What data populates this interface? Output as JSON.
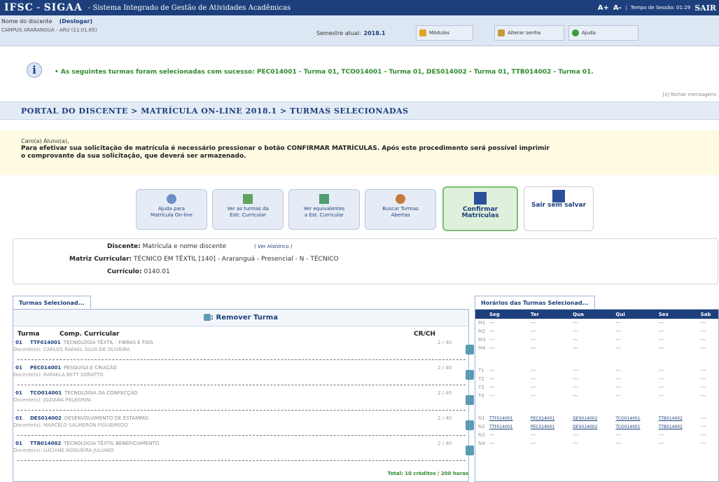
{
  "top": {
    "brand_ifsc": "IFSC",
    "brand_sep": "-",
    "brand_sigaa": "SIGAA",
    "brand_dash": "-",
    "system_name": "Sistema Integrado de Gestão de Atividades Acadêmicas",
    "font_increase": "A+",
    "font_decrease": "A-",
    "session_time": "Tempo de Sessão: 01:29",
    "exit_label": "SAIR"
  },
  "user": {
    "name": "Nome do discente",
    "logout_label": "(Deslogar)",
    "campus": "CAMPUS ARARANGUÁ - ARU (11.01.65)",
    "semester_label": "Semestre atual:",
    "semester_value": "2018.1",
    "modules_label": "Módulos",
    "change_password_label": "Alterar senha",
    "help_label": "Ajuda"
  },
  "message": {
    "info_symbol": "i",
    "text": "• As seguintes turmas foram selecionadas com sucesso: PEC014001 - Turma 01, TCO014001 - Turma 01, DES014002 - Turma 01, TTB014002 - Turma 01.",
    "close_label": "[x] fechar mensagens"
  },
  "breadcrumb": "PORTAL DO DISCENTE > MATRÍCULA ON-LINE 2018.1 > TURMAS SELECIONADAS",
  "notice": {
    "greeting": "Caro(a) Aluno(a),",
    "line1": "Para efetivar sua solicitação de matrícula é necessário pressionar o botão CONFIRMAR MATRÍCULAS. Após este procedimento será possível imprimir",
    "line2": "o comprovante da sua solicitação, que deverá ser armazenado."
  },
  "ops": {
    "help_line1": "Ajuda para",
    "help_line2": "Matrícula On-line",
    "curricular_line1": "Ver as turmas da",
    "curricular_line2": "Estr. Curricular",
    "equiv_line1": "Ver equivalentes",
    "equiv_line2": "a Est. Curricular",
    "open_line1": "Buscar Turmas",
    "open_line2": "Abertas",
    "confirm_line1": "Confirmar",
    "confirm_line2": "Matrículas",
    "exit_label": "Sair sem salvar"
  },
  "student": {
    "discente_label": "Discente:",
    "discente_value": "Matrícula e nome discente",
    "history_link": "( Ver Histórico )",
    "matriz_label": "Matriz Curricular:",
    "matriz_value": "TÉCNICO EM TÊXTIL [140] - Araranguá - Presencial - N - TÉCNICO",
    "curriculo_label": "Currículo:",
    "curriculo_value": "0140.01"
  },
  "left_tab": "Turmas Selecionad...",
  "remove_label": ": Remover Turma",
  "table": {
    "col_turma": "Turma",
    "col_comp": "Comp. Curricular",
    "col_cr": "CR/CH",
    "rows": [
      {
        "turma": "01",
        "code": "TTF014001",
        "name": "TECNOLOGIA TÊXTIL - FIBRAS E FIOS",
        "cr": "2 / 40",
        "docente": "Docente(s): CARLOS RAFAEL SILVA DE OLIVEIRA"
      },
      {
        "turma": "01",
        "code": "PEC014001",
        "name": "PESQUISA E CRIAÇÃO",
        "cr": "2 / 40",
        "docente": "Docente(s): RAFAELA BETT SORATTO"
      },
      {
        "turma": "01",
        "code": "TCO014001",
        "name": "TECNOLOGIA DA CONFECÇÃO",
        "cr": "2 / 40",
        "docente": "Docente(s): JOZIANA PELEGRINI"
      },
      {
        "turma": "01",
        "code": "DES014002",
        "name": "DESENVOLVIMENTO DE ESTAMPAS",
        "cr": "2 / 40",
        "docente": "Docente(s): MARCELO SALMERON FIGUEIREDO"
      },
      {
        "turma": "01",
        "code": "TTB014002",
        "name": "TECNOLOGIA TÊXTIL BENEFICIAMENTO",
        "cr": "2 / 40",
        "docente": "Docente(s): LUCIANE NOGUEIRA JULIANO"
      }
    ],
    "total": "Total: 10 créditos / 200 horas"
  },
  "right_tab": "Horários das Turmas Selecionad...",
  "schedule": {
    "days": [
      "Seg",
      "Ter",
      "Qua",
      "Qui",
      "Sex",
      "Sab"
    ],
    "dash": "---",
    "morning": [
      "M1",
      "M2",
      "M3",
      "M4"
    ],
    "afternoon": [
      "T1",
      "T2",
      "T3",
      "T4"
    ],
    "night": [
      "N1",
      "N2",
      "N3",
      "N4"
    ],
    "night_codes": [
      "TTF014001",
      "PEC014001",
      "DES014002",
      "TCO014001",
      "TTB014002"
    ]
  }
}
